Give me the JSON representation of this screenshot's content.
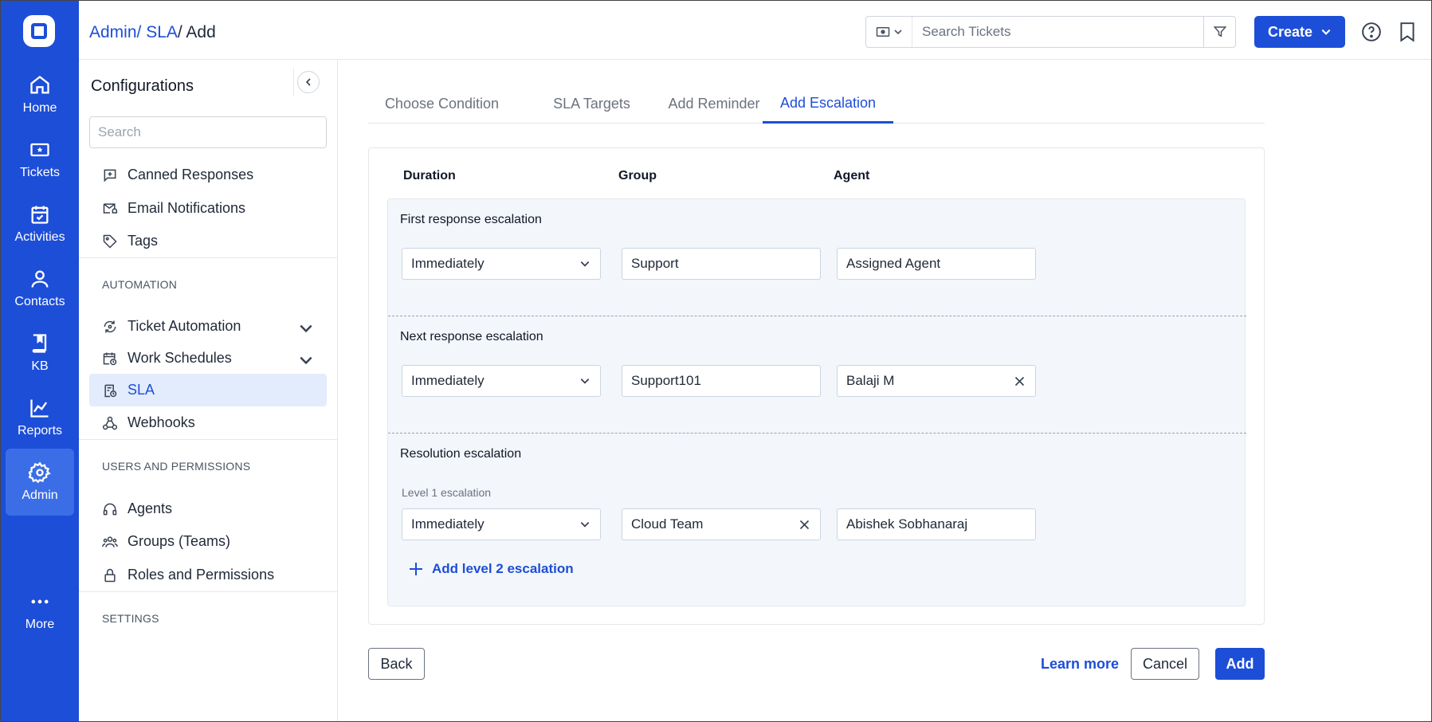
{
  "breadcrumb": {
    "admin": "Admin",
    "sep1": "/ ",
    "sla": "SLA",
    "sep2": "/ ",
    "current": "Add"
  },
  "rail": [
    {
      "label": "Home"
    },
    {
      "label": "Tickets"
    },
    {
      "label": "Activities"
    },
    {
      "label": "Contacts"
    },
    {
      "label": "KB"
    },
    {
      "label": "Reports"
    },
    {
      "label": "Admin"
    },
    {
      "label": "More"
    }
  ],
  "header": {
    "search_placeholder": "Search Tickets",
    "create_label": "Create"
  },
  "config": {
    "title": "Configurations",
    "search_placeholder": "Search",
    "items": [
      "Canned Responses",
      "Email Notifications",
      "Tags"
    ],
    "automation_label": "AUTOMATION",
    "automation_items": [
      "Ticket Automation",
      "Work Schedules",
      "SLA",
      "Webhooks"
    ],
    "users_label": "USERS AND PERMISSIONS",
    "users_items": [
      "Agents",
      "Groups (Teams)",
      "Roles and Permissions"
    ],
    "settings_label": "SETTINGS"
  },
  "tabs": [
    "Choose Condition",
    "SLA Targets",
    "Add Reminder",
    "Add Escalation"
  ],
  "columns": {
    "duration": "Duration",
    "group": "Group",
    "agent": "Agent"
  },
  "first": {
    "title": "First response escalation",
    "duration": "Immediately",
    "group": "Support",
    "agent": "Assigned Agent"
  },
  "next": {
    "title": "Next response escalation",
    "duration": "Immediately",
    "group": "Support101",
    "agent": "Balaji M"
  },
  "resolution": {
    "title": "Resolution escalation",
    "level_label": "Level 1 escalation",
    "duration": "Immediately",
    "group": "Cloud Team",
    "agent": "Abishek Sobhanaraj",
    "add_level": "Add level 2 escalation"
  },
  "footer": {
    "back": "Back",
    "learn_more": "Learn more",
    "cancel": "Cancel",
    "add": "Add"
  },
  "colors": {
    "brand": "#1d4ed8",
    "active_nav_bg": "#e3ecfc",
    "panel_bg": "#f3f6fa"
  }
}
